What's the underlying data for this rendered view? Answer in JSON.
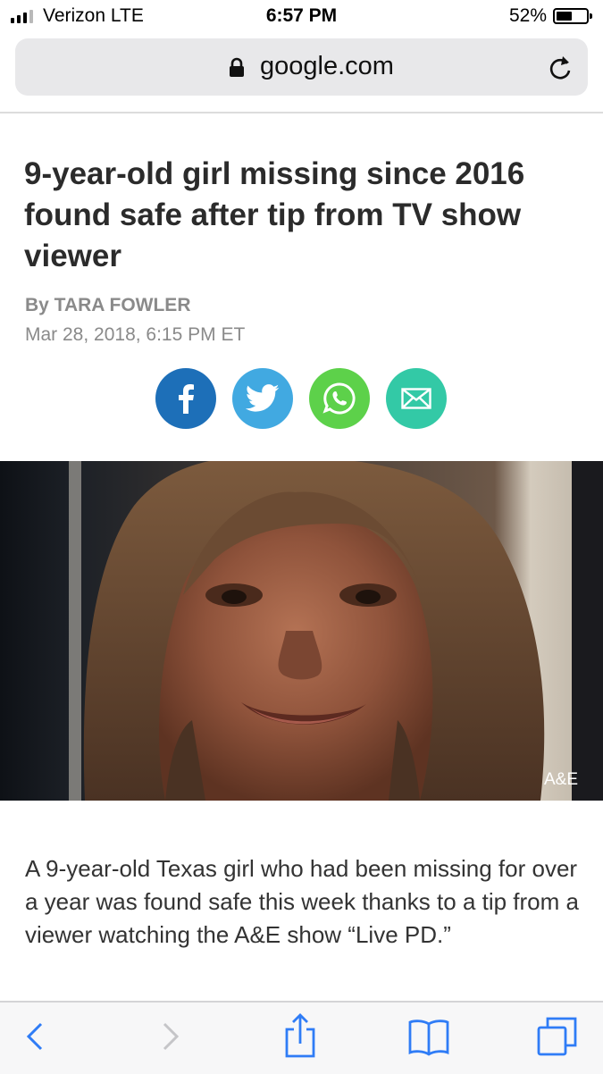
{
  "status_bar": {
    "carrier": "Verizon  LTE",
    "time": "6:57 PM",
    "battery_percent": "52%",
    "battery_level": 0.52,
    "signal_bars": 3
  },
  "address_bar": {
    "url": "google.com",
    "icons": [
      "lock-icon",
      "reload-icon"
    ]
  },
  "article": {
    "headline": "9-year-old girl missing since 2016 found safe after tip from TV show viewer",
    "byline": "By TARA FOWLER",
    "date": "Mar 28, 2018, 6:15 PM ET",
    "share_buttons": [
      {
        "icon": "facebook-icon",
        "color": "#1d6fb8"
      },
      {
        "icon": "twitter-icon",
        "color": "#41a9e1"
      },
      {
        "icon": "whatsapp-icon",
        "color": "#5dd14a"
      },
      {
        "icon": "email-icon",
        "color": "#33c9a6"
      }
    ],
    "photo_credit": "A&E",
    "paragraph": "A 9-year-old Texas girl who had been missing for over a year was found safe this week thanks to a tip from a viewer watching the A&E show “Live PD.”"
  },
  "toolbar": {
    "icons": [
      "back-icon",
      "forward-icon",
      "share-icon",
      "bookmarks-icon",
      "tabs-icon"
    ],
    "accent": "#2f7cf6"
  }
}
